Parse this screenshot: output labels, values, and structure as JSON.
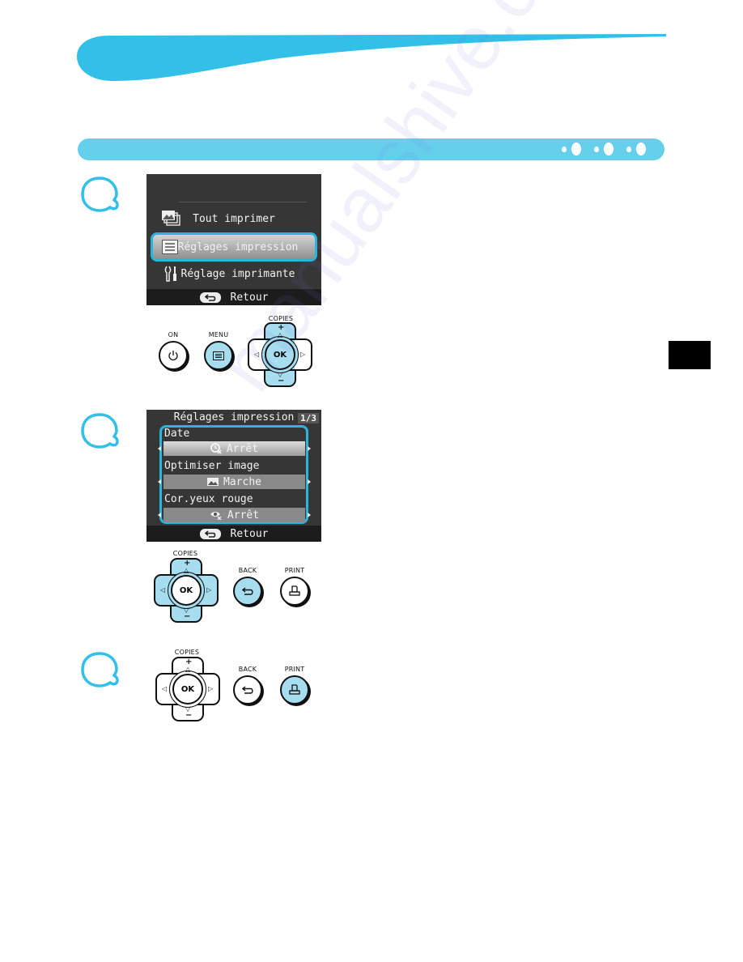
{
  "colors": {
    "accent": "#33c0e8",
    "section_bar": "#66d0ec",
    "button_highlight": "#a6def0",
    "lcd_bg": "#363636",
    "lcd_select_border": "#2cb4dc"
  },
  "steps": [
    {
      "step_marker_icon": "speech-bubble-outline-icon",
      "screen": {
        "menu_items": [
          {
            "icon": "photos-stack-icon",
            "label": "Tout imprimer",
            "selected": false
          },
          {
            "icon": "settings-list-icon",
            "label": "Réglages impression",
            "selected": true
          },
          {
            "icon": "tools-icon",
            "label": "Réglage imprimante",
            "selected": false
          }
        ],
        "footer": {
          "icon": "back-arrow-icon",
          "label": "Retour"
        }
      },
      "buttons": {
        "on": {
          "label": "ON",
          "icon": "power-icon",
          "highlighted": false
        },
        "menu": {
          "label": "MENU",
          "icon": "menu-icon",
          "highlighted": true
        },
        "dpad": {
          "label": "COPIES",
          "center": "OK",
          "plus": "+",
          "minus": "−",
          "highlighted": true
        }
      }
    },
    {
      "step_marker_icon": "speech-bubble-outline-icon",
      "screen": {
        "title": "Réglages impression",
        "page": "1/3",
        "settings": [
          {
            "label": "Date",
            "icon": "date-off-icon",
            "value": "Arrêt",
            "selected": true
          },
          {
            "label": "Optimiser image",
            "icon": "image-icon",
            "value": "Marche",
            "selected": false
          },
          {
            "label": "Cor.yeux rouge",
            "icon": "red-eye-off-icon",
            "value": "Arrêt",
            "selected": false
          }
        ],
        "footer": {
          "icon": "back-arrow-icon",
          "label": "Retour"
        }
      },
      "buttons": {
        "dpad": {
          "label": "COPIES",
          "center": "OK",
          "plus": "+",
          "minus": "−",
          "highlighted": true
        },
        "back": {
          "label": "BACK",
          "icon": "back-arrow-icon",
          "highlighted": true
        },
        "print": {
          "label": "PRINT",
          "icon": "print-icon",
          "highlighted": false
        }
      }
    },
    {
      "step_marker_icon": "speech-bubble-outline-icon",
      "buttons": {
        "dpad": {
          "label": "COPIES",
          "center": "OK",
          "plus": "+",
          "minus": "−",
          "highlighted": false
        },
        "back": {
          "label": "BACK",
          "icon": "back-arrow-icon",
          "highlighted": false
        },
        "print": {
          "label": "PRINT",
          "icon": "print-icon",
          "highlighted": true
        }
      }
    }
  ],
  "watermark": "manualshive.com"
}
